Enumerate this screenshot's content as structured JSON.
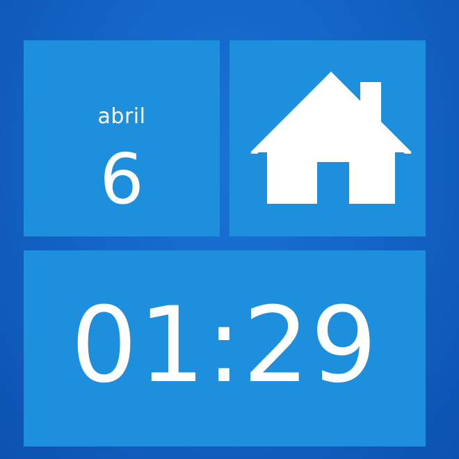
{
  "date_tile": {
    "month": "abril",
    "day": "6"
  },
  "home_tile": {
    "icon": "home-icon"
  },
  "clock_tile": {
    "time": "01:29"
  },
  "colors": {
    "background": "#1262c4",
    "tile": "#1e8fdc",
    "text": "#ffffff"
  }
}
